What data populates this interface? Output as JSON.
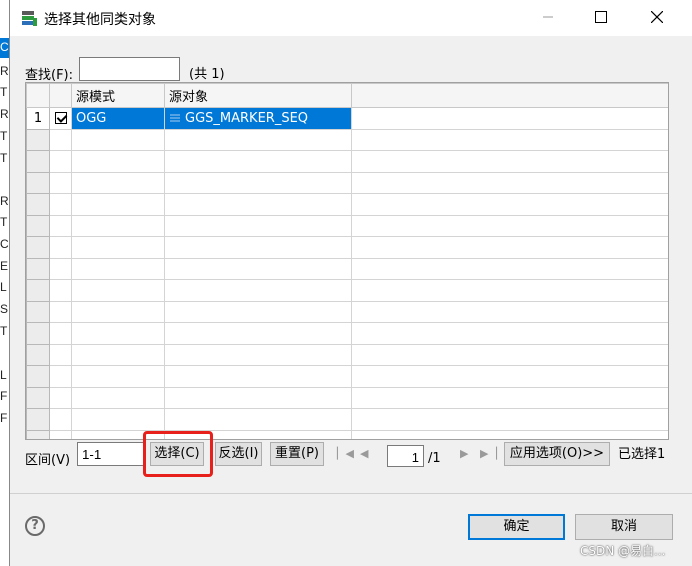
{
  "background_strip": {
    "letters": [
      "C",
      "R",
      "T",
      "R",
      "T",
      "T",
      "R",
      "T",
      "C",
      "E",
      "L",
      "S",
      "T",
      "L",
      "F",
      "F"
    ]
  },
  "window": {
    "title": "选择其他同类对象",
    "icon": "database-stack-icon",
    "controls": [
      "minimize-icon",
      "maximize-icon",
      "close-icon"
    ]
  },
  "search": {
    "label": "查找(F):",
    "value": "",
    "count": "(共 1)"
  },
  "grid": {
    "columns": [
      "源模式",
      "源对象"
    ],
    "rows": [
      {
        "num": "1",
        "checked": true,
        "schema": "OGG",
        "object": "GGS_MARKER_SEQ",
        "selected": true
      }
    ]
  },
  "toolbar": {
    "range_label": "区间(V)",
    "range_value": "1-1",
    "select_button": "选择(C)",
    "invert_button": "反选(I)",
    "reset_button": "重置(P)",
    "page_value": "1",
    "page_total": "/1",
    "apply_button": "应用选项(O)>>",
    "selected_count": "已选择1"
  },
  "footer": {
    "ok_button": "确定",
    "cancel_button": "取消",
    "help_icon": "help-icon",
    "watermark": "CSDN @易白..."
  },
  "colors": {
    "selection": "#0078d7",
    "highlight": "#e8201c",
    "dialog_bg": "#f0f0f0"
  }
}
